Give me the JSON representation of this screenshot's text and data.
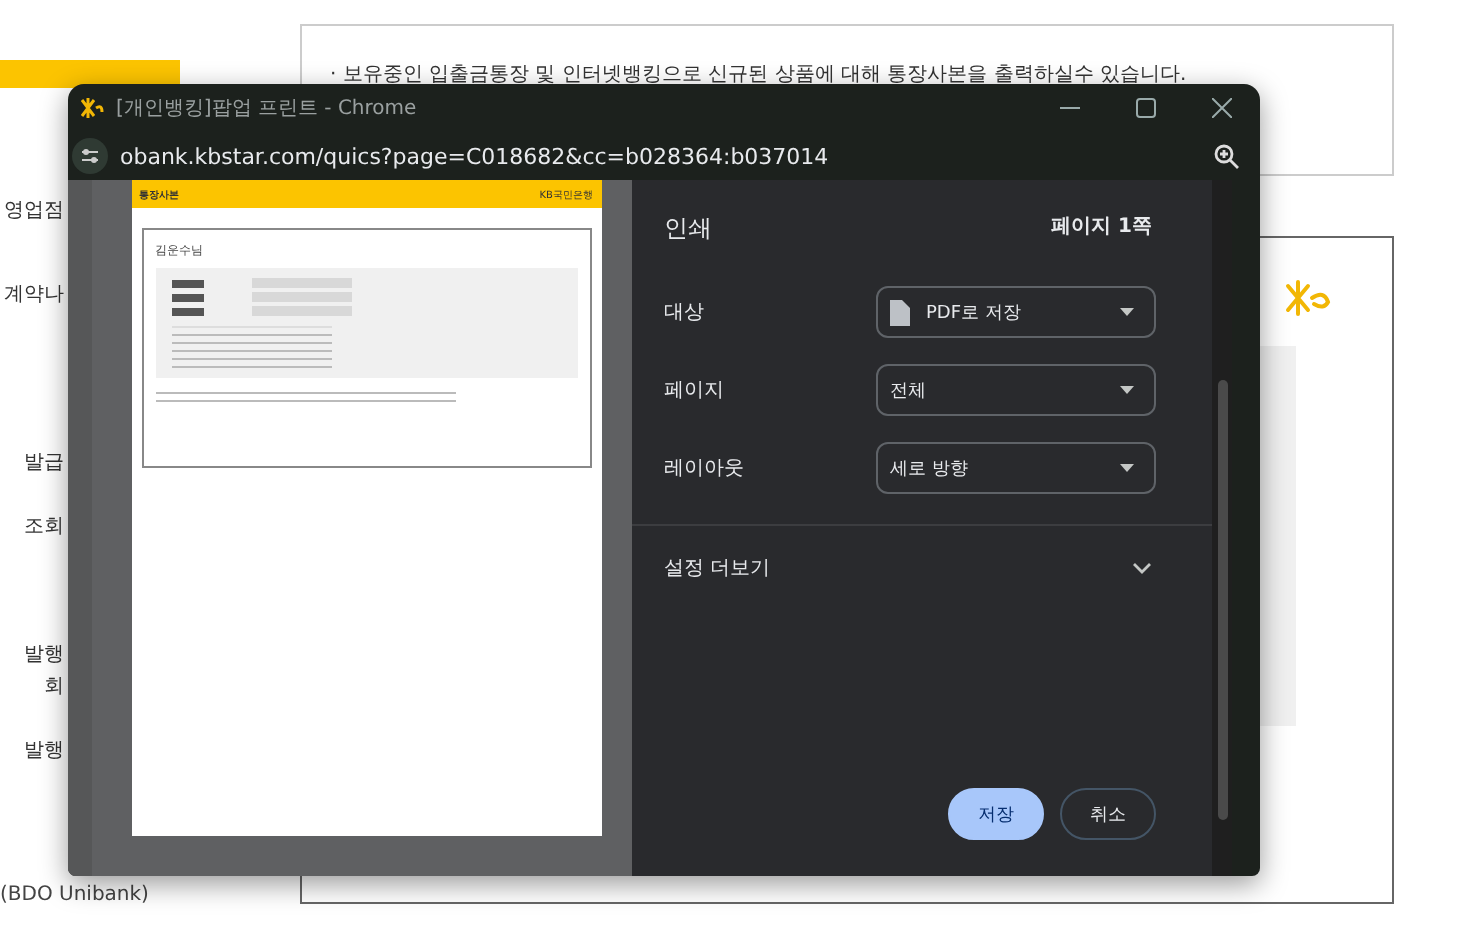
{
  "background_page": {
    "sidebar_items": [
      "영업점",
      "계약나",
      "발급",
      "조회",
      "발행",
      "회",
      "발행"
    ],
    "footer_item": "(BDO Unibank)",
    "notice": "· 보유중인 입출금통장 및 인터넷뱅킹으로 신규된 상품에 대해 통장사본을 출력하실수 있습니다."
  },
  "browser_window": {
    "title": "[개인뱅킹]팝업 프린트 - Chrome",
    "url": "obank.kbstar.com/quics?page=C018682&cc=b028364:b037014",
    "preview": {
      "header": "통장사본",
      "bank_name": "KB국민은행",
      "customer": "김운수님"
    },
    "print_dialog": {
      "title": "인쇄",
      "page_count": "페이지 1쪽",
      "settings": [
        {
          "label": "대상",
          "value": "PDF로 저장",
          "kind": "destination"
        },
        {
          "label": "페이지",
          "value": "전체",
          "kind": "select"
        },
        {
          "label": "레이아웃",
          "value": "세로 방향",
          "kind": "select"
        }
      ],
      "more_settings": {
        "label": "설정 더보기",
        "expanded": false
      },
      "buttons": [
        {
          "label": "저장",
          "kind": "primary"
        },
        {
          "label": "취소",
          "kind": "secondary"
        }
      ]
    }
  }
}
